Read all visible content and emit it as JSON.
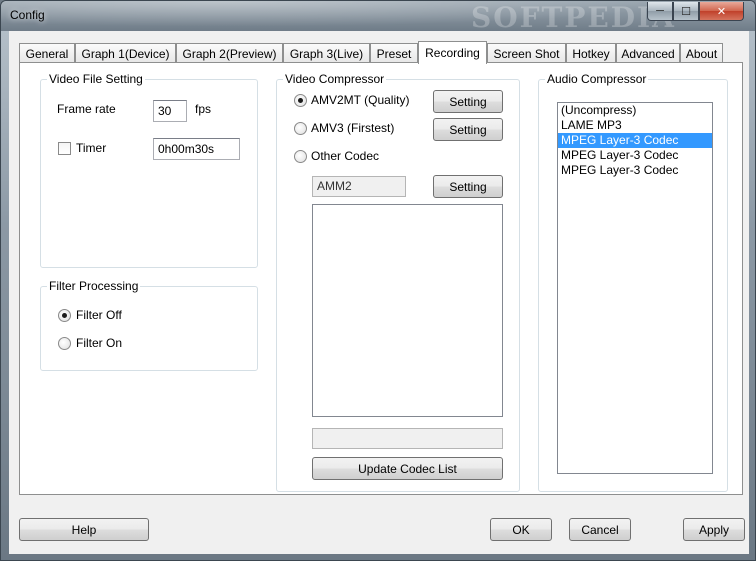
{
  "window": {
    "title": "Config",
    "watermark": "SOFTPEDIA",
    "controls": {
      "minimize": "─",
      "maximize": "☐",
      "close": "✕"
    }
  },
  "tabs": [
    {
      "label": "General"
    },
    {
      "label": "Graph 1(Device)"
    },
    {
      "label": "Graph 2(Preview)"
    },
    {
      "label": "Graph 3(Live)"
    },
    {
      "label": "Preset"
    },
    {
      "label": "Recording"
    },
    {
      "label": "Screen Shot"
    },
    {
      "label": "Hotkey"
    },
    {
      "label": "Advanced"
    },
    {
      "label": "About"
    }
  ],
  "video_file_setting": {
    "title": "Video File Setting",
    "frame_rate_label": "Frame rate",
    "frame_rate_value": "30",
    "fps_label": "fps",
    "timer_label": "Timer",
    "timer_checked": false,
    "timer_value": "0h00m30s"
  },
  "filter_processing": {
    "title": "Filter Processing",
    "options": [
      "Filter Off",
      "Filter On"
    ],
    "selected": "Filter Off"
  },
  "video_compressor": {
    "title": "Video Compressor",
    "options": [
      "AMV2MT (Quality)",
      "AMV3 (Firstest)",
      "Other Codec"
    ],
    "selected": "AMV2MT (Quality)",
    "setting_label": "Setting",
    "codec_value": "AMM2",
    "status_value": "",
    "update_button": "Update Codec List"
  },
  "audio_compressor": {
    "title": "Audio Compressor",
    "items": [
      {
        "label": "(Uncompress)",
        "selected": false
      },
      {
        "label": "LAME MP3",
        "selected": false
      },
      {
        "label": "MPEG Layer-3 Codec",
        "selected": true
      },
      {
        "label": "MPEG Layer-3 Codec",
        "selected": false
      },
      {
        "label": "MPEG Layer-3 Codec",
        "selected": false
      }
    ]
  },
  "footer": {
    "help": "Help",
    "ok": "OK",
    "cancel": "Cancel",
    "apply": "Apply"
  }
}
